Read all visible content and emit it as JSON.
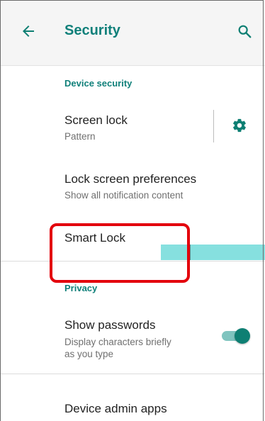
{
  "header": {
    "title": "Security"
  },
  "sections": {
    "device_security": "Device security",
    "privacy": "Privacy"
  },
  "items": {
    "screen_lock": {
      "title": "Screen lock",
      "subtitle": "Pattern"
    },
    "lock_screen_prefs": {
      "title": "Lock screen preferences",
      "subtitle": "Show all notification content"
    },
    "smart_lock": {
      "title": "Smart Lock"
    },
    "show_passwords": {
      "title": "Show passwords",
      "subtitle_line1": "Display characters briefly",
      "subtitle_line2": "as you type",
      "toggle_on": true
    },
    "device_admin": {
      "title": "Device admin apps"
    }
  },
  "colors": {
    "accent": "#10807a",
    "highlight": "#e3000b",
    "cyan_overlay": "#86e0df"
  },
  "icons": [
    "back-arrow-icon",
    "search-icon",
    "gear-icon"
  ]
}
